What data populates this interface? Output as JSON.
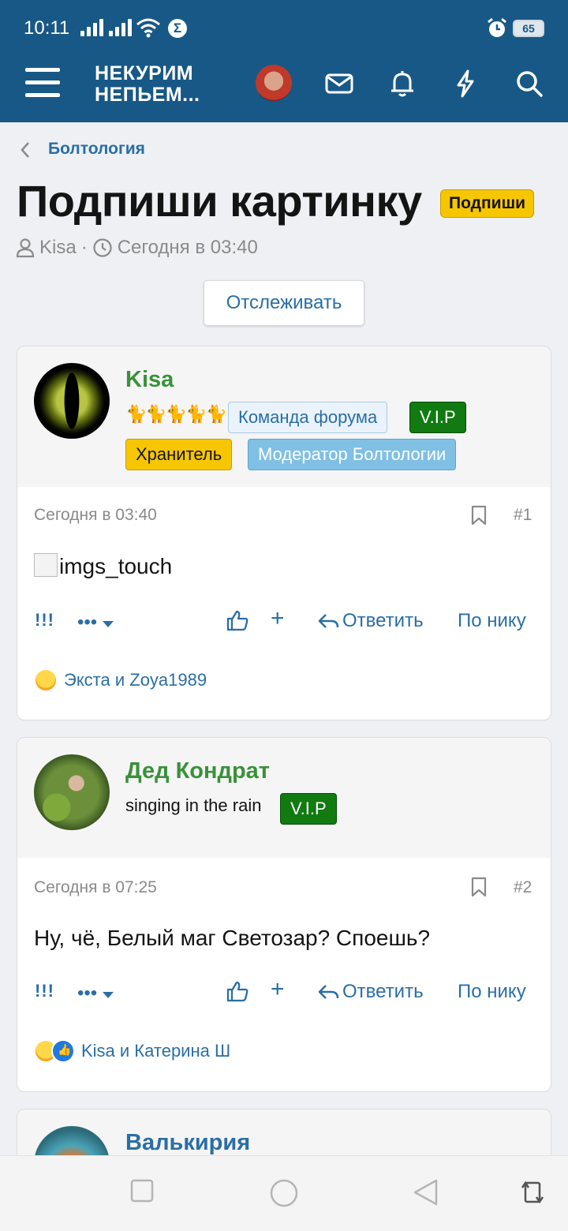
{
  "status_bar": {
    "time": "10:11",
    "battery": "65"
  },
  "header": {
    "logo_line1": "НЕКУРИМ",
    "logo_line2": "НЕПЬЕМ..."
  },
  "breadcrumb": {
    "label": "Болтология"
  },
  "thread": {
    "title": "Подпиши картинку",
    "prefix": "Подпиши",
    "author": "Kisa",
    "separator": "·",
    "date": "Сегодня в 03:40",
    "watch_label": "Отслеживать"
  },
  "actions": {
    "exclaim": "!!!",
    "more": "•••",
    "plus": "+",
    "reply": "Ответить",
    "by_nick": "По нику"
  },
  "posts": [
    {
      "username": "Kisa",
      "cats": "🐈🐈🐈🐈🐈",
      "badges": [
        "Команда форума",
        "V.I.P",
        "Хранитель",
        "Модератор Болтологии"
      ],
      "date": "Сегодня в 03:40",
      "number": "#1",
      "body": "imgs_touch",
      "reactions_text": "Экста и Zoya1989"
    },
    {
      "username": "Дед Кондрат",
      "user_title": "singing in the rain",
      "badges": [
        "V.I.P"
      ],
      "date": "Сегодня в 07:25",
      "number": "#2",
      "body": "Ну, чё, Белый маг Светозар? Споешь?",
      "reactions_text": "Kisa и Катерина Ш"
    },
    {
      "username": "Валькирия"
    }
  ],
  "colors": {
    "header": "#185886",
    "link": "#2a6ea5",
    "username_green": "#39913a",
    "vip_green": "#117a11",
    "prefix_yellow": "#f6c600"
  }
}
